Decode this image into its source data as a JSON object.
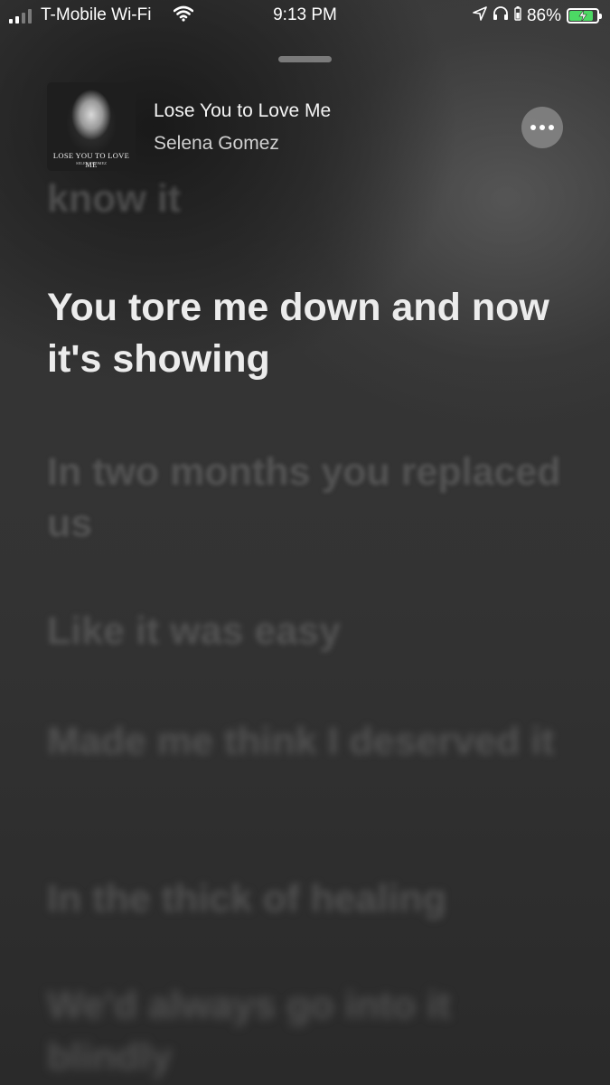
{
  "status_bar": {
    "carrier": "T-Mobile Wi-Fi",
    "time": "9:13 PM",
    "battery_percent": "86%",
    "battery_level": 0.86,
    "signal_bars": 4,
    "signal_active": 2,
    "icons": [
      "wifi-icon",
      "location-arrow-icon",
      "headphones-icon",
      "battery-charging-icon"
    ]
  },
  "now_playing": {
    "title": "Lose You to Love Me",
    "artist": "Selena Gomez",
    "artwork_title": "LOSE YOU TO LOVE ME",
    "artwork_artist": "SELENA GOMEZ"
  },
  "lyrics": {
    "previous": "know it",
    "current": "You tore me down and now it's showing",
    "upcoming": [
      "In two months you replaced us",
      "Like it was easy",
      "Made me think I deserved it",
      "In the thick of healing",
      "We'd always go into it blindly"
    ]
  },
  "colors": {
    "background": "#333333",
    "current_lyric": "#ececec",
    "dim_lyric": "#6e6e6e",
    "battery_fill": "#4cd964"
  }
}
